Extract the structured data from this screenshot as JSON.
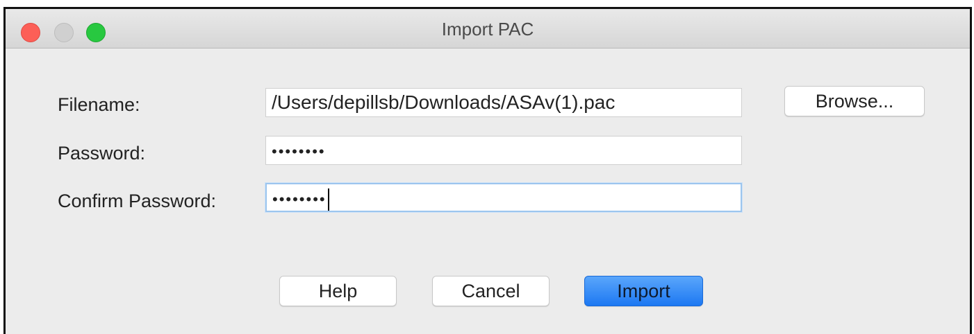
{
  "window": {
    "title": "Import PAC"
  },
  "form": {
    "filename_label": "Filename:",
    "filename_value": "/Users/depillsb/Downloads/ASAv(1).pac",
    "password_label": "Password:",
    "password_value": "••••••••",
    "confirm_label": "Confirm Password:",
    "confirm_value": "••••••••"
  },
  "buttons": {
    "browse": "Browse...",
    "help": "Help",
    "cancel": "Cancel",
    "import": "Import"
  },
  "colors": {
    "accent": "#1d78f2",
    "close": "#fc5f57",
    "zoom": "#28c840"
  }
}
